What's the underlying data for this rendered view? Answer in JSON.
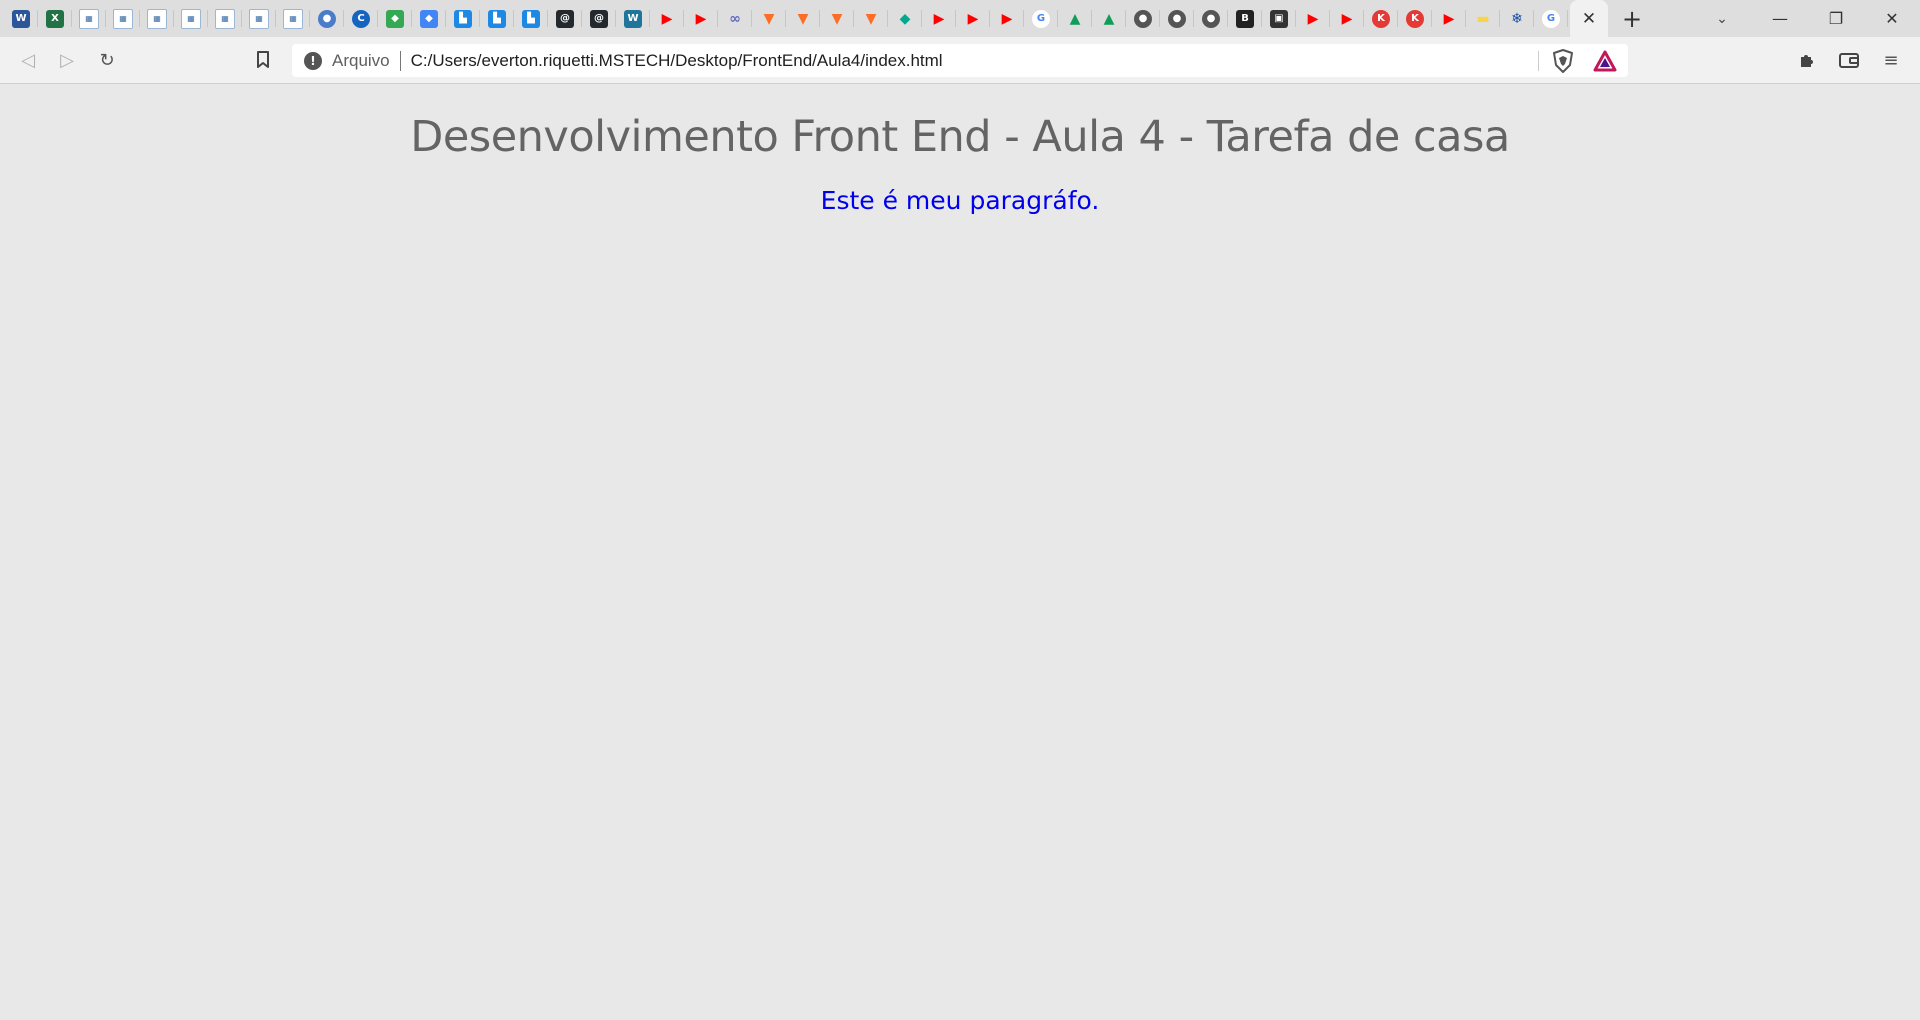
{
  "browser": {
    "pinned_tabs": [
      {
        "icon": "word-icon",
        "glyph": "W",
        "color": "#2b579a"
      },
      {
        "icon": "excel-icon",
        "glyph": "X",
        "color": "#217346"
      },
      {
        "icon": "grid-page-icon",
        "glyph": "▦",
        "color": "grid"
      },
      {
        "icon": "grid-page-icon",
        "glyph": "▦",
        "color": "grid"
      },
      {
        "icon": "grid-page-icon",
        "glyph": "▦",
        "color": "grid"
      },
      {
        "icon": "grid-page-icon",
        "glyph": "▦",
        "color": "grid"
      },
      {
        "icon": "grid-page-icon",
        "glyph": "▦",
        "color": "grid"
      },
      {
        "icon": "grid-page-icon",
        "glyph": "▦",
        "color": "grid"
      },
      {
        "icon": "grid-page-icon",
        "glyph": "▦",
        "color": "grid"
      },
      {
        "icon": "globe-blue-icon",
        "glyph": "●",
        "color": "#4a7cc9"
      },
      {
        "icon": "c-logo-icon",
        "glyph": "C",
        "color": "#1565c0"
      },
      {
        "icon": "diamond-multicolor-icon",
        "glyph": "◆",
        "color": "#34a853"
      },
      {
        "icon": "diamond-multicolor-icon",
        "glyph": "◆",
        "color": "#4285f4"
      },
      {
        "icon": "building-icon",
        "glyph": "▙",
        "color": "#1e88e5"
      },
      {
        "icon": "building-icon",
        "glyph": "▙",
        "color": "#1e88e5"
      },
      {
        "icon": "building-icon",
        "glyph": "▙",
        "color": "#1e88e5"
      },
      {
        "icon": "github-like-icon",
        "glyph": "@",
        "color": "#24292e"
      },
      {
        "icon": "github-like-icon",
        "glyph": "@",
        "color": "#24292e"
      },
      {
        "icon": "wordpress-icon",
        "glyph": "W",
        "color": "#21759b"
      },
      {
        "icon": "youtube-icon",
        "glyph": "▶",
        "color": "#ff0000"
      },
      {
        "icon": "youtube-icon",
        "glyph": "▶",
        "color": "#ff0000"
      },
      {
        "icon": "infinity-icon",
        "glyph": "∞",
        "color": "#5c6bc0"
      },
      {
        "icon": "gitlab-icon",
        "glyph": "▼",
        "color": "#fc6d26"
      },
      {
        "icon": "gitlab-icon",
        "glyph": "▼",
        "color": "#fc6d26"
      },
      {
        "icon": "gitlab-icon",
        "glyph": "▼",
        "color": "#fc6d26"
      },
      {
        "icon": "gitlab-icon",
        "glyph": "▼",
        "color": "#fc6d26"
      },
      {
        "icon": "teal-diamond-icon",
        "glyph": "◆",
        "color": "#00a88f"
      },
      {
        "icon": "youtube-icon",
        "glyph": "▶",
        "color": "#ff0000"
      },
      {
        "icon": "youtube-icon",
        "glyph": "▶",
        "color": "#ff0000"
      },
      {
        "icon": "youtube-icon",
        "glyph": "▶",
        "color": "#ff0000"
      },
      {
        "icon": "google-icon",
        "glyph": "G",
        "color": "#4285f4"
      },
      {
        "icon": "google-drive-icon",
        "glyph": "▲",
        "color": "#0f9d58"
      },
      {
        "icon": "google-drive-icon",
        "glyph": "▲",
        "color": "#0f9d58"
      },
      {
        "icon": "globe-gray-icon",
        "glyph": "●",
        "color": "#555555"
      },
      {
        "icon": "globe-gray-icon",
        "glyph": "●",
        "color": "#555555"
      },
      {
        "icon": "globe-gray-icon",
        "glyph": "●",
        "color": "#555555"
      },
      {
        "icon": "b2b-icon",
        "glyph": "B",
        "color": "#222222"
      },
      {
        "icon": "contact-card-icon",
        "glyph": "▣",
        "color": "#333333"
      },
      {
        "icon": "youtube-icon",
        "glyph": "▶",
        "color": "#ff0000"
      },
      {
        "icon": "youtube-icon",
        "glyph": "▶",
        "color": "#ff0000"
      },
      {
        "icon": "k-logo-icon",
        "glyph": "K",
        "color": "#e53935"
      },
      {
        "icon": "k-logo-icon",
        "glyph": "K",
        "color": "#e53935"
      },
      {
        "icon": "youtube-icon",
        "glyph": "▶",
        "color": "#ff0000"
      },
      {
        "icon": "yellow-page-icon",
        "glyph": "▬",
        "color": "#f7d44a"
      },
      {
        "icon": "snowflake-icon",
        "glyph": "❄",
        "color": "#1a4fa0"
      },
      {
        "icon": "google-icon",
        "glyph": "G",
        "color": "#4285f4"
      }
    ],
    "active_tab_close": "✕",
    "new_tab": "+",
    "tab_search": "⌄",
    "window": {
      "minimize": "—",
      "restore": "❐",
      "close": "✕"
    },
    "toolbar": {
      "back": "◁",
      "forward": "▷",
      "reload": "↻",
      "bookmark": "🔖",
      "info": "!",
      "scheme": "Arquivo",
      "url": "C:/Users/everton.riquetti.MSTECH/Desktop/FrontEnd/Aula4/index.html",
      "extensions": "✦",
      "wallet": "▭",
      "menu": "≡"
    }
  },
  "page": {
    "title": "Desenvolvimento Front End - Aula 4 - Tarefa de casa",
    "paragraph": "Este é meu paragráfo."
  }
}
